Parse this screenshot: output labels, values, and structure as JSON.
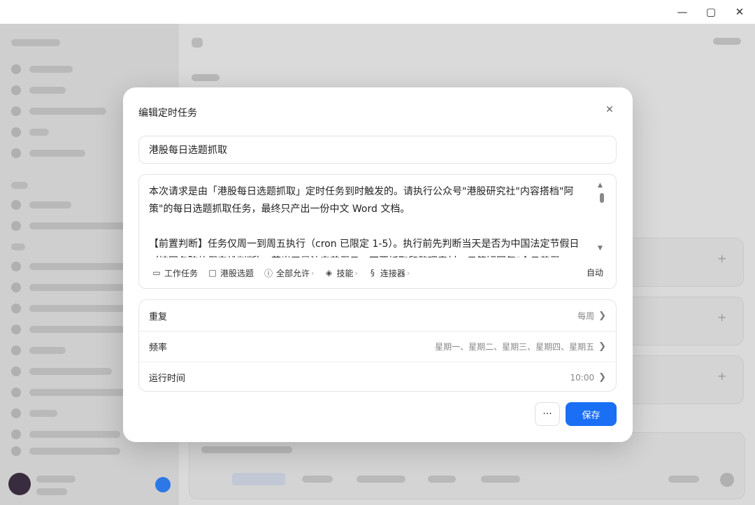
{
  "window": {
    "minimize_icon": "minimize-icon",
    "maximize_icon": "maximize-icon",
    "close_icon": "close-icon"
  },
  "modal": {
    "title": "编辑定时任务",
    "task_name": "港股每日选题抓取",
    "prompt": "本次请求是由「港股每日选题抓取」定时任务到时触发的。请执行公众号\"港股研究社\"内容搭档\"阿策\"的每日选题抓取任务，最终只产出一份中文 Word 文档。\n\n【前置判断】任务仅周一到周五执行（cron 已限定 1-5）。执行前先判断当天是否为中国法定节假日（按国务院放假安排判断）；若当天是法定节假日，不要抓取和整理素材，只简短回复\"今日节假",
    "tools": [
      {
        "icon": "laptop-icon",
        "label": "工作任务",
        "chevron": false
      },
      {
        "icon": "folder-icon",
        "label": "港股选题",
        "chevron": false
      },
      {
        "icon": "permission-icon",
        "label": "全部允许",
        "chevron": true
      },
      {
        "icon": "skills-icon",
        "label": "技能",
        "chevron": true
      },
      {
        "icon": "connector-icon",
        "label": "连接器",
        "chevron": true
      }
    ],
    "model_mode": "自动",
    "settings": {
      "repeat": {
        "label": "重复",
        "value": "每周"
      },
      "frequency": {
        "label": "频率",
        "value": "星期一、星期二、星期三、星期四、星期五"
      },
      "run_time": {
        "label": "运行时间",
        "value": "10:00"
      }
    },
    "more_label": "···",
    "save_label": "保存"
  },
  "colors": {
    "primary": "#1a6ff5",
    "overlay_bg": "#d9d9d9"
  }
}
